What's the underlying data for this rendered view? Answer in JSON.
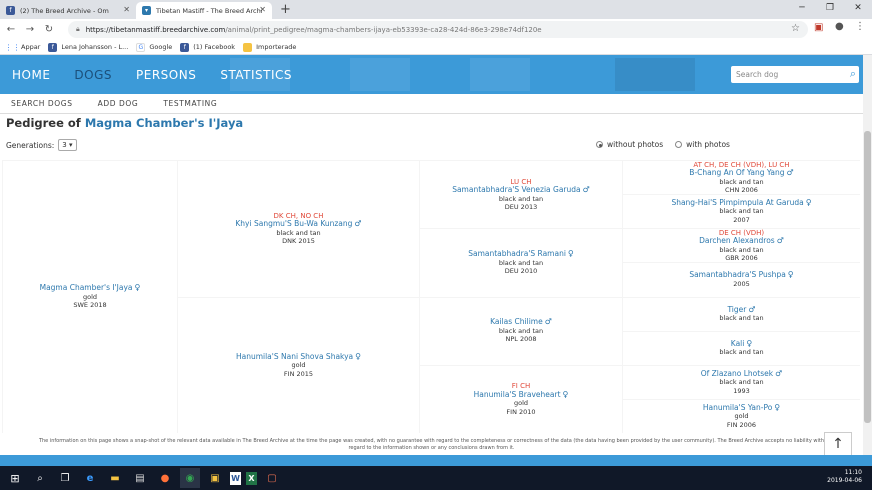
{
  "browser": {
    "tabs": [
      {
        "title": "(2) The Breed Archive - Om",
        "favicon_color": "#3b5998"
      },
      {
        "title": "Tibetan Mastiff - The Breed Archi",
        "favicon_color": "#2d78ad"
      }
    ],
    "url_host": "https://tibetanmastiff.breedarchive.com",
    "url_path": "/animal/print_pedigree/magma-chambers-ijaya-eb53393e-ca28-424d-86e3-298e74df120e",
    "bookmarks": [
      "Appar",
      "Lena Johansson - L...",
      "Google",
      "(1) Facebook",
      "Importerade"
    ]
  },
  "site": {
    "nav": [
      "HOME",
      "DOGS",
      "PERSONS",
      "STATISTICS"
    ],
    "search_placeholder": "Search dog",
    "subnav": [
      "SEARCH DOGS",
      "ADD DOG",
      "TESTMATING"
    ]
  },
  "page": {
    "title_prefix": "Pedigree of",
    "title_dog": "Magma Chamber's I'Jaya",
    "generations_label": "Generations:",
    "generations_value": "3",
    "without_photos": "without photos",
    "with_photos": "with photos"
  },
  "pedigree": {
    "g0": {
      "name": "Magma Chamber's I'Jaya",
      "sex": "♀",
      "color": "gold",
      "info": "SWE 2018"
    },
    "g1": [
      {
        "title": "DK CH, NO CH",
        "name": "Khyi Sangmu'S Bu-Wa Kunzang",
        "sex": "♂",
        "color": "black and tan",
        "info": "DNK 2015"
      },
      {
        "title": "",
        "name": "Hanumila'S Nani Shova Shakya",
        "sex": "♀",
        "color": "gold",
        "info": "FIN 2015"
      }
    ],
    "g2": [
      {
        "title": "LU CH",
        "name": "Samantabhadra'S Venezia Garuda",
        "sex": "♂",
        "color": "black and tan",
        "info": "DEU 2013"
      },
      {
        "title": "",
        "name": "Samantabhadra'S Ramani",
        "sex": "♀",
        "color": "black and tan",
        "info": "DEU 2010"
      },
      {
        "title": "",
        "name": "Kailas Chilime",
        "sex": "♂",
        "color": "black and tan",
        "info": "NPL 2008"
      },
      {
        "title": "FI CH",
        "name": "Hanumila'S Braveheart",
        "sex": "♀",
        "color": "gold",
        "info": "FIN 2010"
      }
    ],
    "g3": [
      {
        "title": "AT CH, DE CH (VDH), LU CH",
        "name": "B-Chang An Of Yang Yang",
        "sex": "♂",
        "color": "black and tan",
        "info": "CHN 2006"
      },
      {
        "title": "",
        "name": "Shang-Hai'S Pimpimpula At Garuda",
        "sex": "♀",
        "color": "black and tan",
        "info": "2007"
      },
      {
        "title": "DE CH (VDH)",
        "name": "Darchen Alexandros",
        "sex": "♂",
        "color": "black and tan",
        "info": "GBR 2006"
      },
      {
        "title": "",
        "name": "Samantabhadra'S Pushpa",
        "sex": "♀",
        "color": "",
        "info": "2005"
      },
      {
        "title": "",
        "name": "Tiger",
        "sex": "♂",
        "color": "black and tan",
        "info": ""
      },
      {
        "title": "",
        "name": "Kali",
        "sex": "♀",
        "color": "black and tan",
        "info": ""
      },
      {
        "title": "",
        "name": "Of Zlazano Lhotsek",
        "sex": "♂",
        "color": "black and tan",
        "info": "1993"
      },
      {
        "title": "",
        "name": "Hanumila'S Yan-Po",
        "sex": "♀",
        "color": "gold",
        "info": "FIN 2006"
      }
    ]
  },
  "footer_text": "The information on this page shows a snap-shot of the relevant data available in The Breed Archive at the time the page was created, with no guarantee with regard to the completeness or correctness of the data (the data having been provided by the user community). The Breed Archive accepts no liability with regard to the information shown or any conclusions drawn from it.",
  "taskbar": {
    "time": "11:10",
    "date": "2019-04-06"
  }
}
